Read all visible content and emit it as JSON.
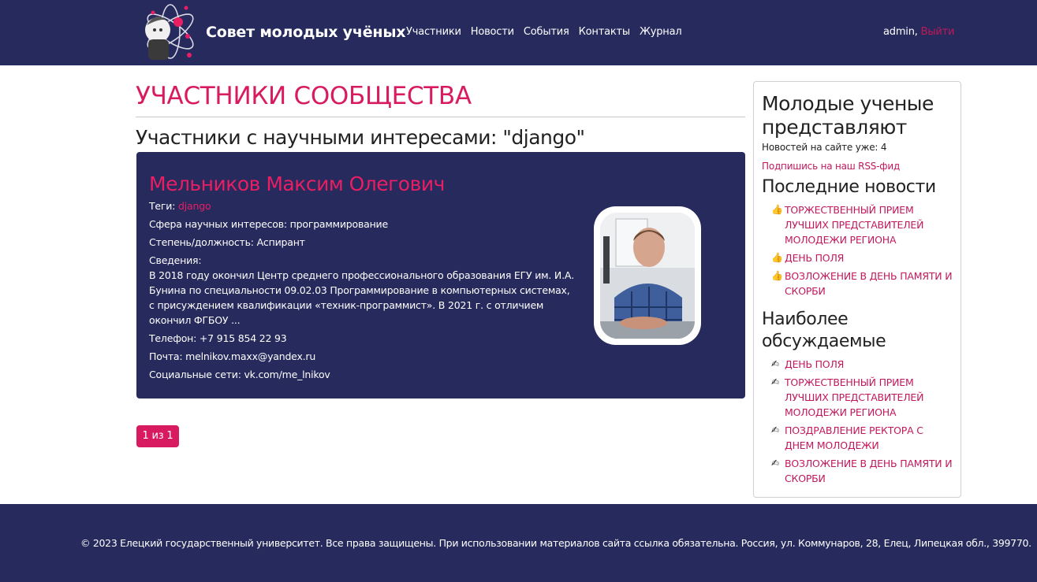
{
  "header": {
    "brand": "Совет молодых учёных",
    "nav": [
      "Участники",
      "Новости",
      "События",
      "Контакты",
      "Журнал"
    ],
    "user": "admin,",
    "logout": "Выйти"
  },
  "main": {
    "title": "УЧАСТНИКИ СООБЩЕСТВА",
    "subtitle": "Участники с научными интересами: \"django\""
  },
  "member": {
    "name": "Мельников Максим Олегович",
    "tags_label": "Теги:",
    "tag": "django",
    "field": "Сфера научных интересов: программирование",
    "degree": "Степень/должность: Аспирант",
    "about_label": "Сведения:",
    "about": "В 2018 году окончил Центр среднего профессионального образования ЕГУ им. И.А. Бунина по специальности 09.02.03 Программирование в компьютерных системах, с присуждением квалификации «техник-программист». В 2021 г. с отличием окончил ФГБОУ ...",
    "phone": "Телефон: +7 915 854 22 93",
    "email": "Почта: melnikov.maxx@yandex.ru",
    "social": "Социальные сети: vk.com/me_lnikov"
  },
  "pagination": {
    "label": "1 из 1"
  },
  "sidebar": {
    "title": "Молодые ученые представляют",
    "news_count": "Новостей на сайте уже: 4",
    "rss": "Подпишись на наш RSS-фид",
    "latest_heading": "Последние новости",
    "latest": [
      "ТОРЖЕСТВЕННЫЙ ПРИЕМ ЛУЧШИХ ПРЕДСТАВИТЕЛЕЙ МОЛОДЕЖИ РЕГИОНА",
      "ДЕНЬ ПОЛЯ",
      "ВОЗЛОЖЕНИЕ В ДЕНЬ ПАМЯТИ И СКОРБИ"
    ],
    "discussed_heading": "Наиболее обсуждаемые",
    "discussed": [
      "ДЕНЬ ПОЛЯ",
      "ТОРЖЕСТВЕННЫЙ ПРИЕМ ЛУЧШИХ ПРЕДСТАВИТЕЛЕЙ МОЛОДЕЖИ РЕГИОНА",
      "ПОЗДРАВЛЕНИЕ РЕКТОРА С ДНЕМ МОЛОДЕЖИ",
      "ВОЗЛОЖЕНИЕ В ДЕНЬ ПАМЯТИ И СКОРБИ"
    ],
    "icons": {
      "latest": "thumbs-up-icon",
      "discussed": "writing-hand-icon"
    }
  },
  "footer": {
    "text": "© 2023 Елецкий государственный университет. Все права защищены. При использовании материалов сайта ссылка обязательна. Россия, ул. Коммунаров, 28, Елец, Липецкая обл., 399770."
  },
  "colors": {
    "navy": "#262a5c",
    "accent": "#d81b60",
    "link": "#c2185b"
  }
}
